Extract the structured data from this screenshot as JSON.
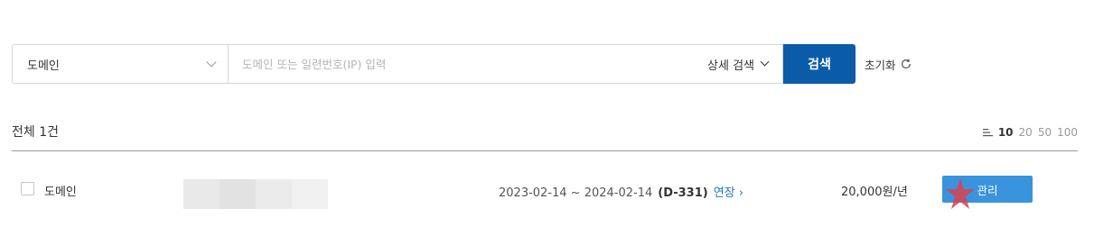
{
  "search": {
    "type_select": "도메인",
    "placeholder": "도메인 또는 일련번호(IP) 입력",
    "detail_toggle": "상세 검색",
    "submit_label": "검색",
    "reset_label": "초기화"
  },
  "list": {
    "total_label": "전체 1건",
    "page_sizes": [
      "10",
      "20",
      "50",
      "100"
    ],
    "active_page_size": "10"
  },
  "rows": [
    {
      "type": "도메인",
      "start": "2023-02-14",
      "end": "2024-02-14",
      "period": "2023-02-14 ~ 2024-02-14",
      "dday": "(D-331)",
      "renew_label": "연장",
      "price": "20,000원/년",
      "manage_label": "관리"
    }
  ],
  "colors": {
    "primary": "#0b5ca8",
    "manage_button": "#3a93dd",
    "link": "#1f74c9",
    "annotation": "#d9434e"
  },
  "icons": [
    "chevron-down-icon",
    "refresh-icon",
    "list-icon",
    "chevron-right-icon"
  ]
}
